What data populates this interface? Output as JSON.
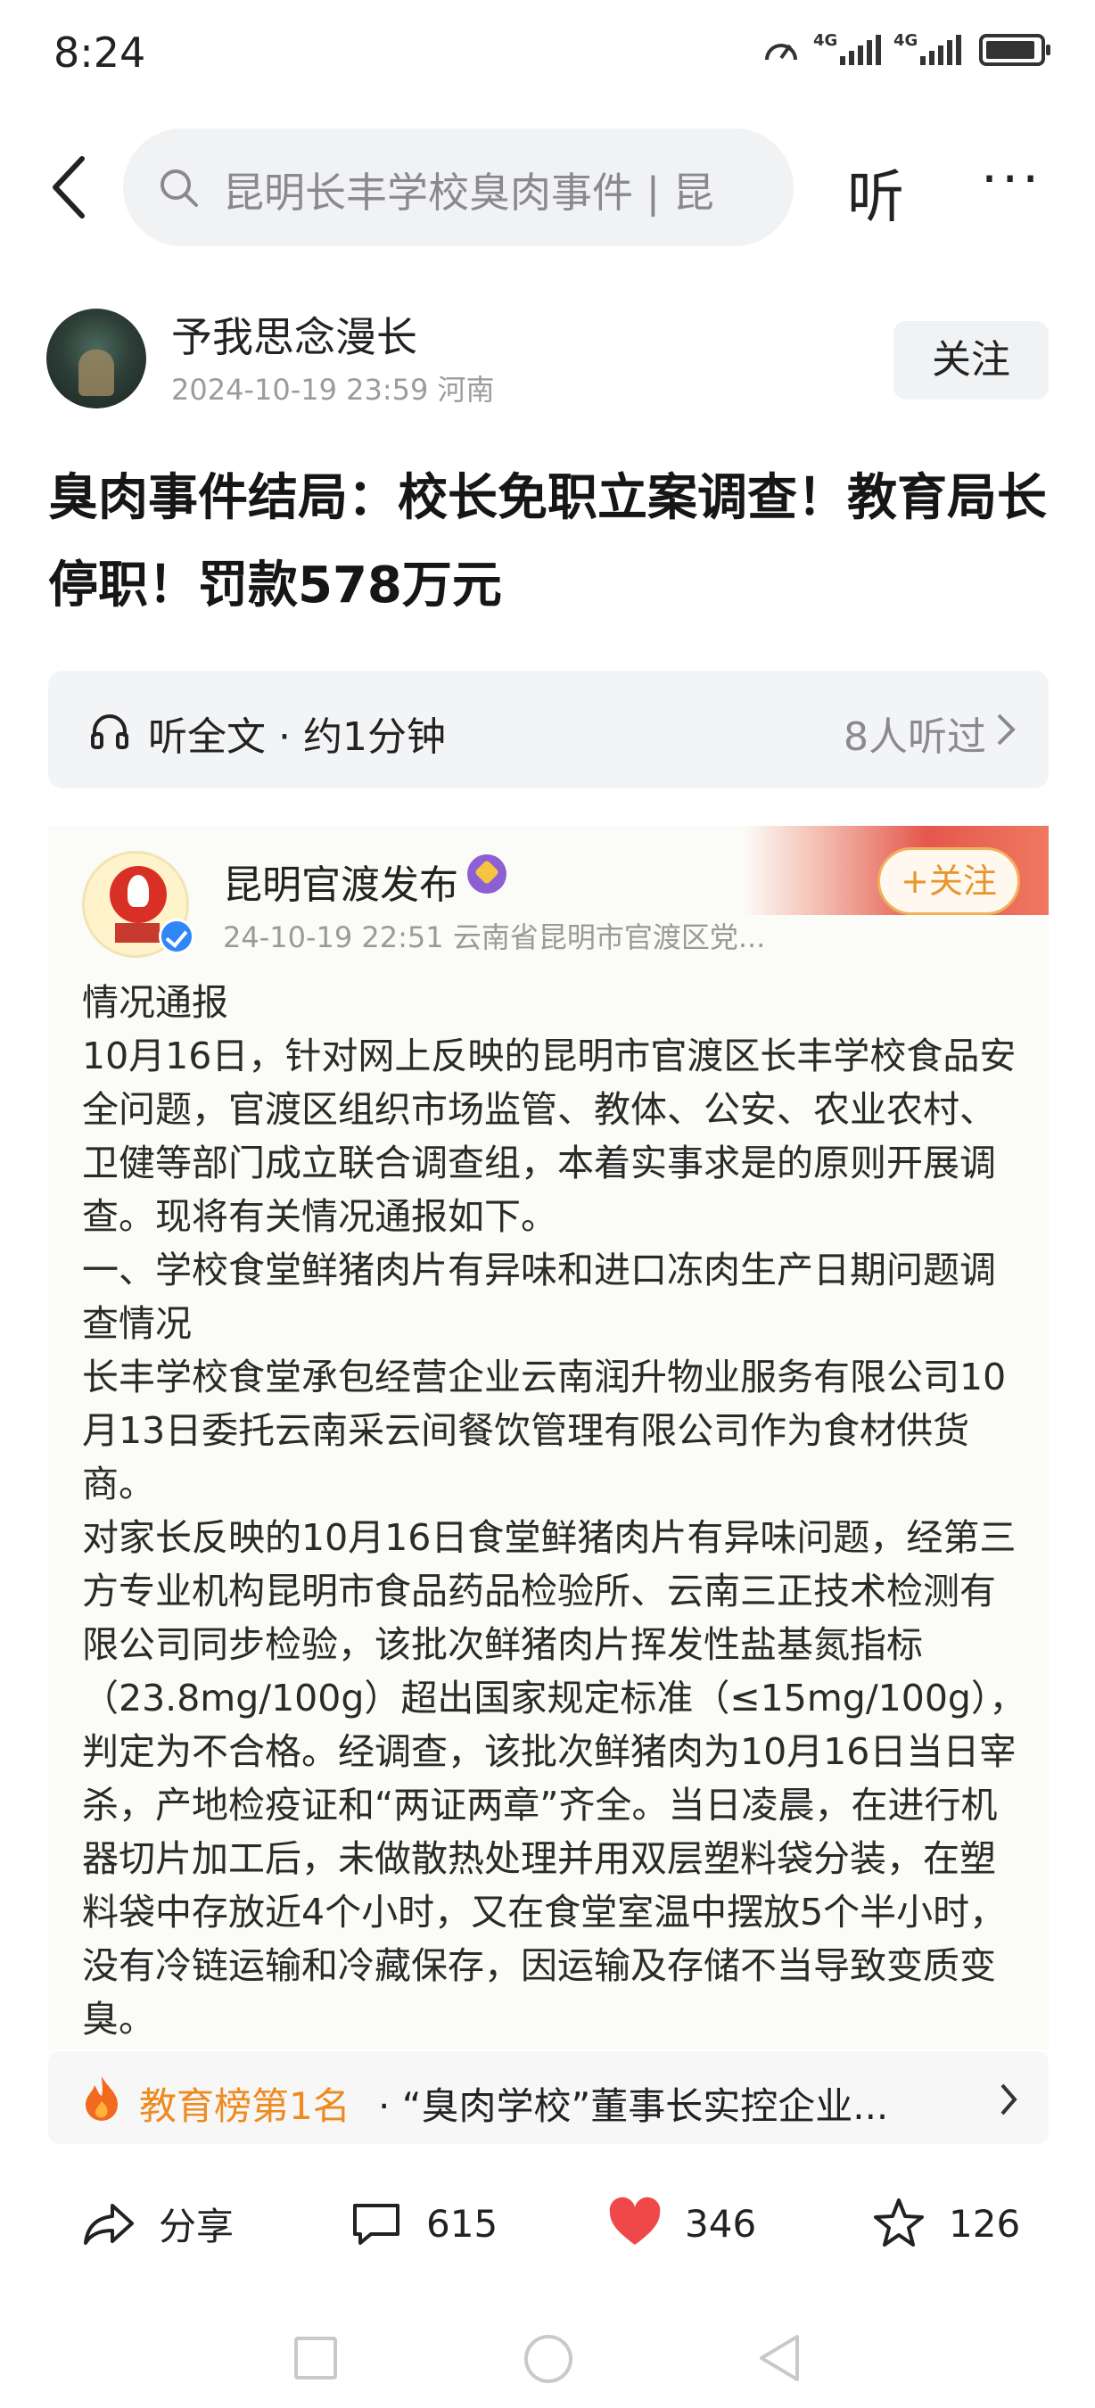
{
  "status_bar": {
    "time": "8:24",
    "signal1_label": "4G",
    "signal2_label": "4G",
    "icons": [
      "speed-icon",
      "signal-icon",
      "signal-icon",
      "battery-icon"
    ]
  },
  "top_bar": {
    "search_text": "昆明长丰学校臭肉事件 | 昆",
    "listen_label": "听",
    "more_label": "···"
  },
  "author": {
    "name": "予我思念漫长",
    "meta": "2024-10-19  23:59  河南",
    "follow_label": "关注"
  },
  "article": {
    "headline": "臭肉事件结局：校长免职立案调查！教育局长停职！罚款578万元",
    "listen_label": "听全文 · 约1分钟",
    "listen_count": "8人听过"
  },
  "embedded_post": {
    "account_name": "昆明官渡发布",
    "follow_label": "+关注",
    "meta": "24-10-19 22:51   云南省昆明市官渡区党...",
    "paragraphs": [
      "情况通报",
      "10月16日，针对网上反映的昆明市官渡区长丰学校食品安全问题，官渡区组织市场监管、教体、公安、农业农村、卫健等部门成立联合调查组，本着实事求是的原则开展调查。现将有关情况通报如下。",
      "一、学校食堂鲜猪肉片有异味和进口冻肉生产日期问题调查情况",
      "长丰学校食堂承包经营企业云南润升物业服务有限公司10月13日委托云南采云间餐饮管理有限公司作为食材供货商。",
      "对家长反映的10月16日食堂鲜猪肉片有异味问题，经第三方专业机构昆明市食品药品检验所、云南三正技术检测有限公司同步检验，该批次鲜猪肉片挥发性盐基氮指标（23.8mg/100g）超出国家规定标准（≤15mg/100g），判定为不合格。经调查，该批次鲜猪肉为10月16日当日宰杀，产地检疫证和“两证两章”齐全。当日凌晨，在进行机器切片加工后，未做散热处理并用双层塑料袋分装，在塑料袋中存放近4个小时，又在食堂室温中摆放5个半小时，没有冷链运输和冷藏保存，因运输及存储不当导致变质变臭。"
    ]
  },
  "ranking": {
    "title": "教育榜第1名",
    "text": " · “臭肉学校”董事长实控企业..."
  },
  "actions": {
    "share_label": "分享",
    "comment_count": "615",
    "like_count": "346",
    "favorite_count": "126"
  },
  "colors": {
    "accent_orange": "#ee8a1e",
    "like_red": "#f04848",
    "muted_gray": "#9b9b9b"
  }
}
